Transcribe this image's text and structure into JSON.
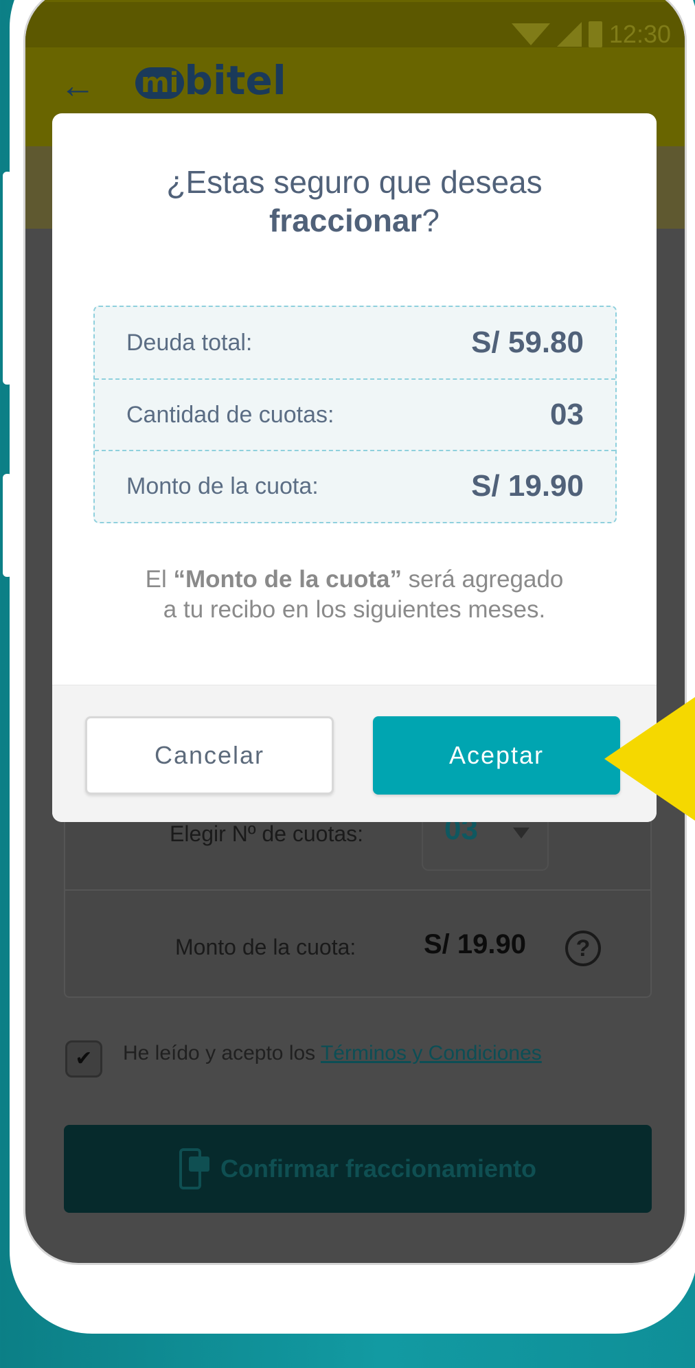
{
  "status_bar": {
    "time": "12:30"
  },
  "header": {
    "back_icon": "arrow-left-icon",
    "logo_text": "bitel",
    "logo_prefix": "mi"
  },
  "background": {
    "installments_label": "Elegir Nº de  cuotas:",
    "installments_value": "03",
    "installment_amount_label": "Monto de la cuota:",
    "installment_amount_value": "S/ 19.90",
    "terms_prefix": "He leído y acepto los ",
    "terms_link": "Términos y Condiciones",
    "terms_checked": true,
    "confirm_label": "Confirmar fraccionamiento"
  },
  "dialog": {
    "title_line1": "¿Estas seguro que deseas",
    "title_bold": "fraccionar",
    "title_suffix": "?",
    "rows": [
      {
        "label": "Deuda total:",
        "value": "S/ 59.80"
      },
      {
        "label": "Cantidad de cuotas:",
        "value": "03"
      },
      {
        "label": "Monto de la cuota:",
        "value": "S/ 19.90"
      }
    ],
    "note_prefix": "El ",
    "note_bold": "“Monto de la cuota”",
    "note_rest_line1": " será agregado",
    "note_line2": "a tu recibo en los siguientes meses.",
    "cancel_label": "Cancelar",
    "accept_label": "Aceptar"
  },
  "colors": {
    "accent": "#00a5b1",
    "title_text": "#506179",
    "highlight_pointer": "#f5d800"
  }
}
